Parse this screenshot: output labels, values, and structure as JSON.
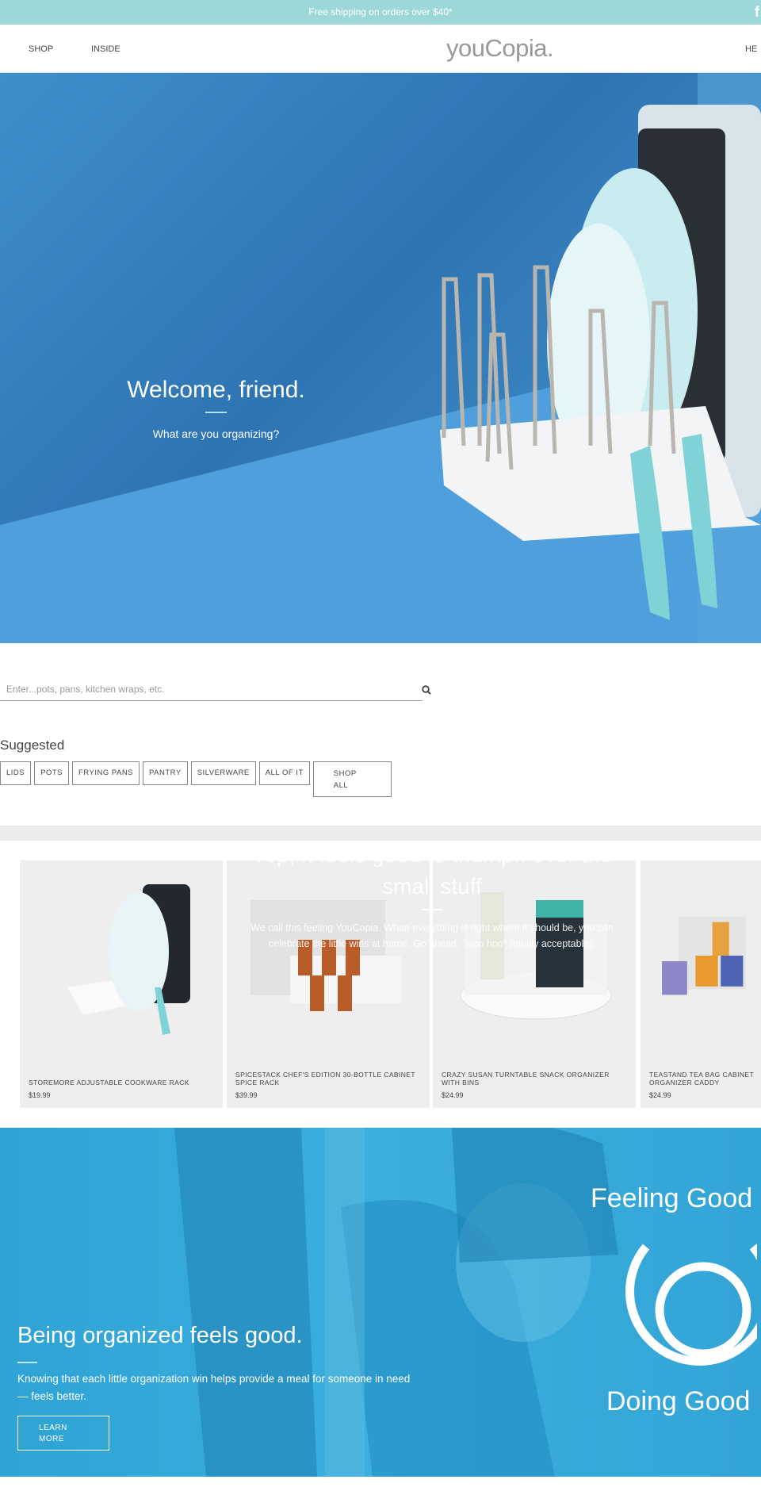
{
  "announcement": "Free shipping on orders over $40*",
  "social": {
    "facebook_icon": "f"
  },
  "nav": {
    "left": [
      "SHOP",
      "INSIDE"
    ],
    "logo": "youCopia.",
    "right": "HE"
  },
  "hero": {
    "title": "Welcome, friend.",
    "subtitle": "What are you organizing?"
  },
  "search": {
    "placeholder": "Enter...pots, pans, kitchen wraps, etc.",
    "icon": "search-icon"
  },
  "suggested": {
    "title": "Suggested",
    "chips": [
      "LIDS",
      "POTS",
      "FRYING PANS",
      "PANTRY",
      "SILVERWARE",
      "ALL OF IT"
    ],
    "shop_all": [
      "SHOP",
      "ALL"
    ]
  },
  "products": [
    {
      "name": "STOREMORE ADJUSTABLE COOKWARE RACK",
      "price": "$19.99"
    },
    {
      "name": "SPICESTACK CHEF'S EDITION 30-BOTTLE CABINET SPICE RACK",
      "price": "$39.99"
    },
    {
      "name": "CRAZY SUSAN TURNTABLE SNACK ORGANIZER WITH BINS",
      "price": "$24.99"
    },
    {
      "name": "TEASTAND TEA BAG CABINET ORGANIZER CADDY",
      "price": "$24.99"
    }
  ],
  "feeling": {
    "title": "Yep, it feels good to triumph over the small stuff",
    "body": "We call this feeling YouCopia. When everything is right where it should be, you can celebrate the little wins at home. Go ahead, \"woo hoo\" (totally acceptable)."
  },
  "give": {
    "title": "Being organized feels good.",
    "body": "Knowing that each little organization win helps provide a meal for someone in need — feels better.",
    "button": [
      "LEARN",
      "MORE"
    ],
    "badge_top": "Feeling Good",
    "badge_bottom": "Doing Good"
  },
  "colors": {
    "topbar": "#9dd8d8",
    "hero_blue": "#2e74b3",
    "give_blue": "#33a4d6"
  }
}
